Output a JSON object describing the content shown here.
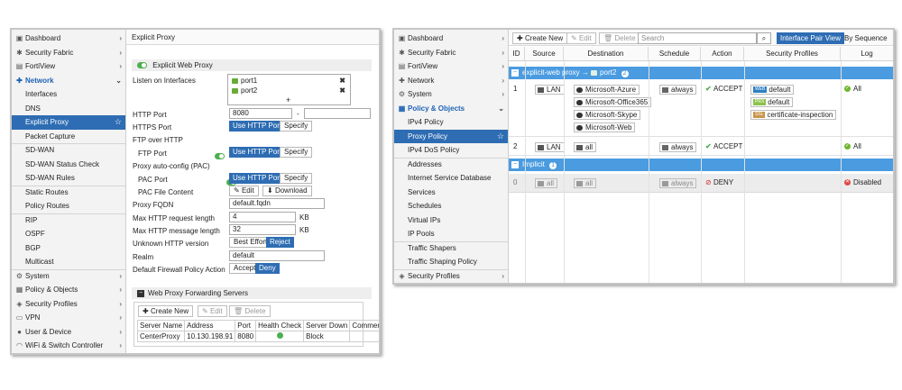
{
  "left": {
    "sidebar": {
      "items": [
        {
          "label": "Dashboard",
          "icon": "dashboard-icon",
          "glyph": "▣",
          "chev": "›"
        },
        {
          "label": "Security Fabric",
          "icon": "security-fabric-icon",
          "glyph": "✱",
          "chev": "›"
        },
        {
          "label": "FortiView",
          "icon": "fortiview-icon",
          "glyph": "▤",
          "chev": "›"
        },
        {
          "label": "Network",
          "icon": "network-icon",
          "glyph": "✚",
          "chev": "⌄"
        },
        {
          "label": "Interfaces"
        },
        {
          "label": "DNS"
        },
        {
          "label": "Explicit Proxy"
        },
        {
          "label": "Packet Capture"
        },
        {
          "label": "SD-WAN"
        },
        {
          "label": "SD-WAN Status Check"
        },
        {
          "label": "SD-WAN Rules"
        },
        {
          "label": "Static Routes"
        },
        {
          "label": "Policy Routes"
        },
        {
          "label": "RIP"
        },
        {
          "label": "OSPF"
        },
        {
          "label": "BGP"
        },
        {
          "label": "Multicast"
        },
        {
          "label": "System",
          "icon": "system-gear-icon",
          "glyph": "⚙",
          "chev": "›"
        },
        {
          "label": "Policy & Objects",
          "icon": "policy-objects-icon",
          "glyph": "▦",
          "chev": "›"
        },
        {
          "label": "Security Profiles",
          "icon": "security-profiles-icon",
          "glyph": "◈",
          "chev": "›"
        },
        {
          "label": "VPN",
          "icon": "vpn-icon",
          "glyph": "▭",
          "chev": "›"
        },
        {
          "label": "User & Device",
          "icon": "user-device-icon",
          "glyph": "●",
          "chev": "›"
        },
        {
          "label": "WiFi & Switch Controller",
          "icon": "wifi-icon",
          "glyph": "◠",
          "chev": "›"
        }
      ]
    },
    "title": "Explicit Proxy",
    "explicit_web_proxy": "Explicit Web Proxy",
    "labels": {
      "listen_on_interfaces": "Listen on Interfaces",
      "http_port": "HTTP Port",
      "https_port": "HTTPS Port",
      "ftp_over_http": "FTP over HTTP",
      "ftp_port": "FTP Port",
      "proxy_auto_config": "Proxy auto-config (PAC)",
      "pac_port": "PAC Port",
      "pac_file_content": "PAC File Content",
      "proxy_fqdn": "Proxy FQDN",
      "max_request": "Max HTTP request length",
      "max_message": "Max HTTP message length",
      "unknown_version": "Unknown HTTP version",
      "realm": "Realm",
      "default_action": "Default Firewall Policy Action"
    },
    "interfaces": [
      "port1",
      "port2"
    ],
    "plus": "+",
    "remove_glyph": "✖",
    "http_port_value": "8080",
    "dash": "-",
    "use_http_port": "Use HTTP Port",
    "specify": "Specify",
    "edit": "Edit",
    "download": "Download",
    "proxy_fqdn_value": "default.fqdn",
    "max_request_value": "4",
    "max_message_value": "32",
    "kb": "KB",
    "best_effort": "Best Effort",
    "reject": "Reject",
    "realm_value": "default",
    "accept": "Accept",
    "deny": "Deny",
    "forwarding_section": "Web Proxy Forwarding Servers",
    "fwd_toolbar": {
      "create_new": "Create New",
      "edit": "Edit",
      "delete": "Delete"
    },
    "fwd_table": {
      "columns": [
        "Server Name",
        "Address",
        "Port",
        "Health Check",
        "Server Down",
        "Comments"
      ],
      "rows": [
        {
          "name": "CenterProxy",
          "address": "10.130.198.91",
          "port": "8080",
          "server_down": "Block",
          "comments": ""
        }
      ]
    }
  },
  "right": {
    "sidebar": {
      "items": [
        {
          "label": "Dashboard",
          "icon": "dashboard-icon",
          "glyph": "▣",
          "chev": "›"
        },
        {
          "label": "Security Fabric",
          "icon": "security-fabric-icon",
          "glyph": "✱",
          "chev": "›"
        },
        {
          "label": "FortiView",
          "icon": "fortiview-icon",
          "glyph": "▤",
          "chev": "›"
        },
        {
          "label": "Network",
          "icon": "network-icon",
          "glyph": "✚",
          "chev": "›"
        },
        {
          "label": "System",
          "icon": "system-gear-icon",
          "glyph": "⚙",
          "chev": "›"
        },
        {
          "label": "Policy & Objects",
          "icon": "policy-objects-icon",
          "glyph": "▦",
          "chev": "⌄"
        },
        {
          "label": "IPv4 Policy"
        },
        {
          "label": "Proxy Policy"
        },
        {
          "label": "IPv4 DoS Policy"
        },
        {
          "label": "Addresses"
        },
        {
          "label": "Internet Service Database"
        },
        {
          "label": "Services"
        },
        {
          "label": "Schedules"
        },
        {
          "label": "Virtual IPs"
        },
        {
          "label": "IP Pools"
        },
        {
          "label": "Traffic Shapers"
        },
        {
          "label": "Traffic Shaping Policy"
        },
        {
          "label": "Security Profiles",
          "icon": "security-profiles-icon",
          "glyph": "◈",
          "chev": "›"
        }
      ]
    },
    "toolbar": {
      "create_new": "Create New",
      "edit": "Edit",
      "delete": "Delete",
      "search_placeholder": "Search",
      "interface_pair_view": "Interface Pair View",
      "by_sequence": "By Sequence"
    },
    "columns": [
      "ID",
      "Source",
      "Destination",
      "Schedule",
      "Action",
      "Security Profiles",
      "Log"
    ],
    "group1": {
      "label": "explicit-web proxy",
      "arrow": "→",
      "port": "port2",
      "count": "2"
    },
    "group2": {
      "label": "Implicit",
      "count": "1"
    },
    "rows": {
      "r1": {
        "id": "1",
        "source": "LAN",
        "destinations": [
          "Microsoft-Azure",
          "Microsoft-Office365",
          "Microsoft-Skype",
          "Microsoft-Web"
        ],
        "schedule": "always",
        "action": "ACCEPT",
        "profiles": [
          {
            "tag": "WEB",
            "name": "default",
            "color": "#2e7fc4"
          },
          {
            "tag": "PRX",
            "name": "default",
            "color": "#8bc34a"
          },
          {
            "tag": "SSL",
            "name": "certificate-inspection",
            "color": "#c8954a"
          }
        ],
        "log": "All"
      },
      "r2": {
        "id": "2",
        "source": "LAN",
        "destination": "all",
        "schedule": "always",
        "action": "ACCEPT",
        "log": "All"
      },
      "r0": {
        "id": "0",
        "source": "all",
        "destination": "all",
        "schedule": "always",
        "action": "DENY",
        "log": "Disabled"
      }
    }
  }
}
